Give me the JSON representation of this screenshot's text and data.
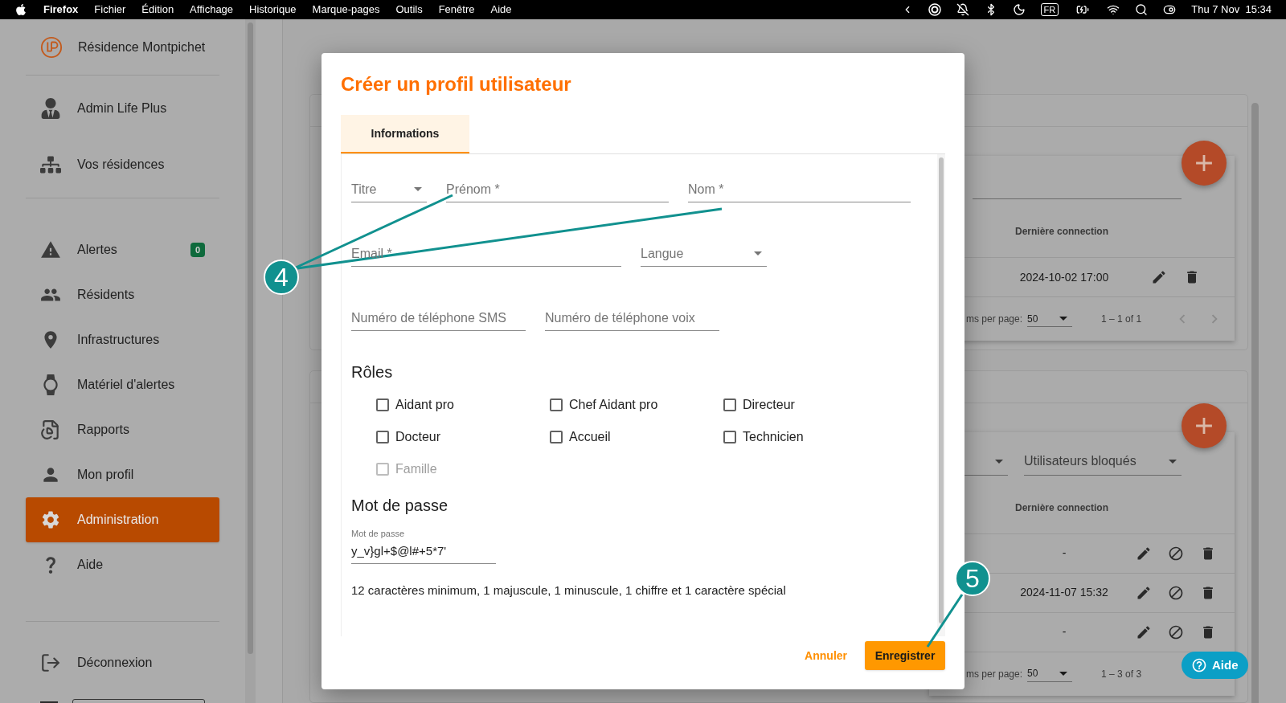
{
  "menubar": {
    "app": "Firefox",
    "menus": [
      "Fichier",
      "Édition",
      "Affichage",
      "Historique",
      "Marque-pages",
      "Outils",
      "Fenêtre",
      "Aide"
    ],
    "input_source": "FR",
    "clock": "Thu 7 Nov  15:34"
  },
  "sidebar": {
    "residence": "Résidence Montpichet",
    "top_items": [
      {
        "label": "Admin Life Plus"
      },
      {
        "label": "Vos résidences"
      }
    ],
    "nav_items": [
      {
        "label": "Alertes",
        "badge": "0",
        "selected": false
      },
      {
        "label": "Résidents",
        "selected": false
      },
      {
        "label": "Infrastructures",
        "selected": false
      },
      {
        "label": "Matériel d'alertes",
        "selected": false
      },
      {
        "label": "Rapports",
        "selected": false
      },
      {
        "label": "Mon profil",
        "selected": false
      },
      {
        "label": "Administration",
        "selected": true
      },
      {
        "label": "Aide",
        "selected": false
      }
    ],
    "bottom_items": [
      {
        "label": "Déconnexion"
      }
    ]
  },
  "background": {
    "panels": [
      {
        "filters": [
          {
            "kind": "search"
          }
        ],
        "column": "Dernière connection",
        "rows": [
          {
            "last_connection": "2024-10-02 17:00",
            "blockable": false
          }
        ],
        "footer": {
          "per_page_label": "ms per page:",
          "per_page": "50",
          "range": "1 – 1 of 1",
          "nav_arrows": true
        }
      },
      {
        "filters": [
          {
            "kind": "select"
          },
          {
            "kind": "select",
            "value": "Utilisateurs bloqués"
          }
        ],
        "column": "Dernière connection",
        "rows": [
          {
            "last_connection": "-",
            "blockable": true
          },
          {
            "last_connection": "2024-11-07 15:32",
            "blockable": true
          },
          {
            "last_connection": "-",
            "blockable": true
          }
        ],
        "footer": {
          "per_page_label": "ms per page:",
          "per_page": "50",
          "range": "1 – 3 of 3",
          "nav_arrows": false
        }
      }
    ],
    "help_button": "Aide"
  },
  "dialog": {
    "title": "Créer un profil utilisateur",
    "tabs": [
      {
        "label": "Informations",
        "selected": true
      }
    ],
    "field_rows": [
      [
        {
          "kind": "select",
          "placeholder": "Titre"
        },
        {
          "kind": "text",
          "placeholder": "Prénom *"
        },
        {
          "kind": "text",
          "placeholder": "Nom *"
        }
      ],
      [
        {
          "kind": "text",
          "placeholder": "Email *"
        },
        {
          "kind": "select",
          "placeholder": "Langue"
        }
      ],
      [
        {
          "kind": "text",
          "placeholder": "Numéro de téléphone SMS"
        },
        {
          "kind": "text",
          "placeholder": "Numéro de téléphone voix"
        }
      ]
    ],
    "roles": {
      "heading": "Rôles",
      "items": [
        {
          "label": "Aidant pro",
          "checked": false,
          "disabled": false
        },
        {
          "label": "Chef Aidant pro",
          "checked": false,
          "disabled": false
        },
        {
          "label": "Directeur",
          "checked": false,
          "disabled": false
        },
        {
          "label": "Docteur",
          "checked": false,
          "disabled": false
        },
        {
          "label": "Accueil",
          "checked": false,
          "disabled": false
        },
        {
          "label": "Technicien",
          "checked": false,
          "disabled": false
        },
        {
          "label": "Famille",
          "checked": false,
          "disabled": true
        }
      ]
    },
    "password": {
      "heading": "Mot de passe",
      "label": "Mot de passe",
      "value": "y_v}gl+$@l#+5*7'",
      "hint": "12 caractères minimum, 1 majuscule, 1 minuscule, 1 chiffre et 1 caractère spécial"
    },
    "buttons": {
      "cancel": "Annuler",
      "save": "Enregistrer"
    }
  },
  "annotations": [
    {
      "number": "4"
    },
    {
      "number": "5"
    }
  ]
}
